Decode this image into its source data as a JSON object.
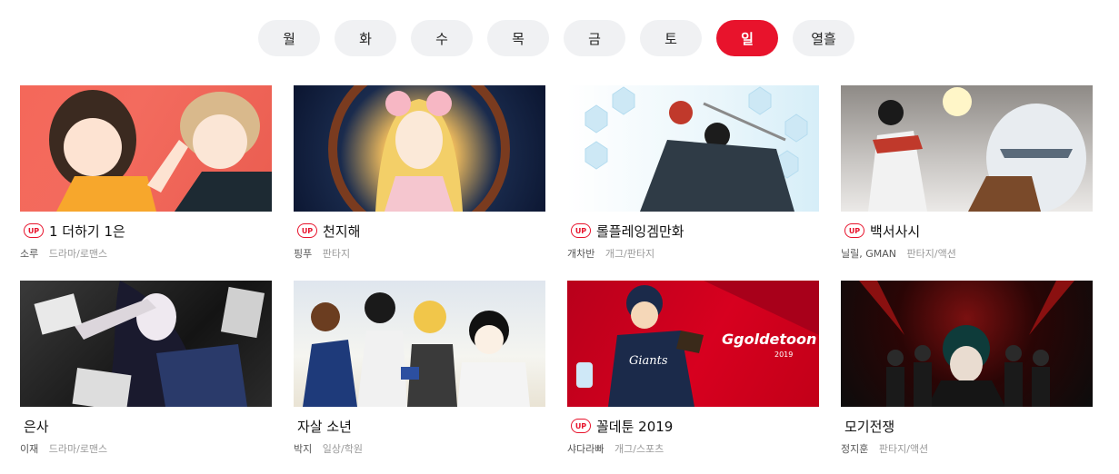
{
  "tabs": [
    {
      "label": "월"
    },
    {
      "label": "화"
    },
    {
      "label": "수"
    },
    {
      "label": "목"
    },
    {
      "label": "금"
    },
    {
      "label": "토"
    },
    {
      "label": "일",
      "active": true
    },
    {
      "label": "열흘"
    }
  ],
  "up_label": "UP",
  "cards": [
    {
      "title": "1 더하기 1은",
      "author": "소루",
      "genre": "드라마/로맨스",
      "up": true
    },
    {
      "title": "천지해",
      "author": "핑푸",
      "genre": "판타지",
      "up": true
    },
    {
      "title": "롤플레잉겜만화",
      "author": "개차반",
      "genre": "개그/판타지",
      "up": true
    },
    {
      "title": "백서사시",
      "author": "닐릴, GMAN",
      "genre": "판타지/액션",
      "up": true
    },
    {
      "title": "은사",
      "author": "이재",
      "genre": "드라마/로맨스",
      "up": false
    },
    {
      "title": "자살 소년",
      "author": "박지",
      "genre": "일상/학원",
      "up": false
    },
    {
      "title": "꼴데툰 2019",
      "author": "샤다라빠",
      "genre": "개그/스포츠",
      "up": true
    },
    {
      "title": "모기전쟁",
      "author": "정지훈",
      "genre": "판타지/액션",
      "up": false
    }
  ],
  "thumb7_logo": "Ggoldetoon",
  "thumb7_year": "2019",
  "thumb7_jersey": "Giants",
  "colors": {
    "accent": "#e8132c",
    "tab_bg": "#f0f1f3",
    "genre": "#999999"
  }
}
